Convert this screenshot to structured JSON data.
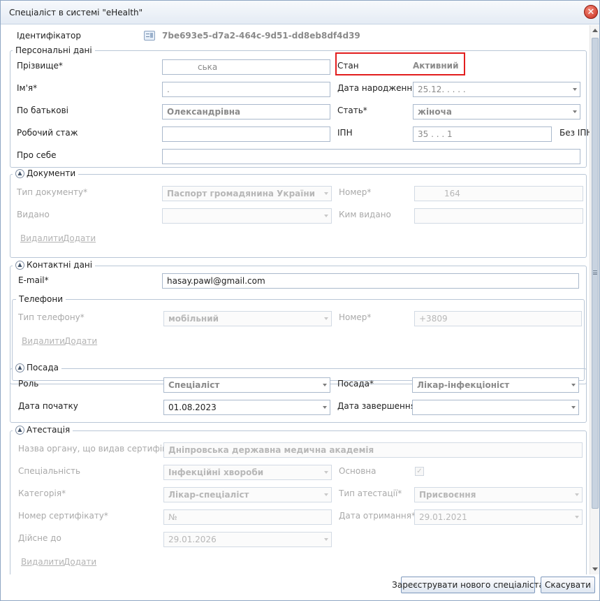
{
  "window": {
    "title": "Спеціаліст в системі \"eHealth\"",
    "close_symbol": "✕"
  },
  "identifier": {
    "label": "Ідентифікатор",
    "value": "7be693e5-d7a2-464c-9d51-dd8eb8df4d39",
    "icon": "id-card-icon"
  },
  "personal": {
    "title": "Персональні дані",
    "surname": {
      "label": "Прізвище*",
      "value": "ська"
    },
    "status": {
      "label": "Стан",
      "value": "Активний"
    },
    "first_name": {
      "label": "Ім'я*",
      "value": "."
    },
    "birth_date": {
      "label": "Дата народження",
      "value": "25.12. . . . ."
    },
    "patronymic": {
      "label": "По батькові",
      "value": "Олександрівна"
    },
    "gender": {
      "label": "Стать*",
      "value": "жіноча"
    },
    "experience": {
      "label": "Робочий стаж",
      "value": ""
    },
    "tax_id": {
      "label": "ІПН",
      "value": "35 . . . 1",
      "no_tax_label": "Без ІПН"
    },
    "about": {
      "label": "Про себе",
      "value": ""
    }
  },
  "documents": {
    "title": "Документи",
    "doc_type": {
      "label": "Тип документу*",
      "value": "Паспорт громадянина України"
    },
    "number": {
      "label": "Номер*",
      "value": "164"
    },
    "issued": {
      "label": "Видано",
      "value": ""
    },
    "issued_by": {
      "label": "Ким видано",
      "value": ""
    },
    "delete": "Видалити",
    "add": "Додати"
  },
  "contacts": {
    "title": "Контактні дані",
    "email": {
      "label": "E-mail*",
      "value": "hasay.pawl@gmail.com"
    },
    "phones": {
      "title": "Телефони",
      "phone_type": {
        "label": "Тип телефону*",
        "value": "мобільний"
      },
      "number": {
        "label": "Номер*",
        "value": "+3809"
      },
      "delete": "Видалити",
      "add": "Додати"
    }
  },
  "position": {
    "title": "Посада",
    "role": {
      "label": "Роль",
      "value": "Спеціаліст"
    },
    "post": {
      "label": "Посада*",
      "value": "Лікар-інфекціоніст"
    },
    "start_date": {
      "label": "Дата початку",
      "value": "01.08.2023"
    },
    "end_date": {
      "label": "Дата завершення",
      "value": ""
    }
  },
  "attestation": {
    "title": "Атестація",
    "issuer": {
      "label": "Назва органу, що видав сертифікат*",
      "value": "Дніпровська державна медична академія"
    },
    "specialty": {
      "label": "Спеціальність",
      "value": "Інфекційні хвороби"
    },
    "main": {
      "label": "Основна",
      "checked": true
    },
    "category": {
      "label": "Категорія*",
      "value": "Лікар-спеціаліст"
    },
    "attestation_type": {
      "label": "Тип атестації*",
      "value": "Присвоєння"
    },
    "cert_number": {
      "label": "Номер сертифікату*",
      "value": "№"
    },
    "received_date": {
      "label": "Дата отримання*",
      "value": "29.01.2021"
    },
    "valid_until": {
      "label": "Дійсне до",
      "value": "29.01.2026"
    },
    "delete": "Видалити",
    "add": "Додати"
  },
  "footer": {
    "register_button": "Зареєструвати нового спеціаліста",
    "cancel_button": "Скасувати"
  },
  "colors": {
    "highlight": "#e21e1e",
    "accent": "#7e99bd"
  }
}
